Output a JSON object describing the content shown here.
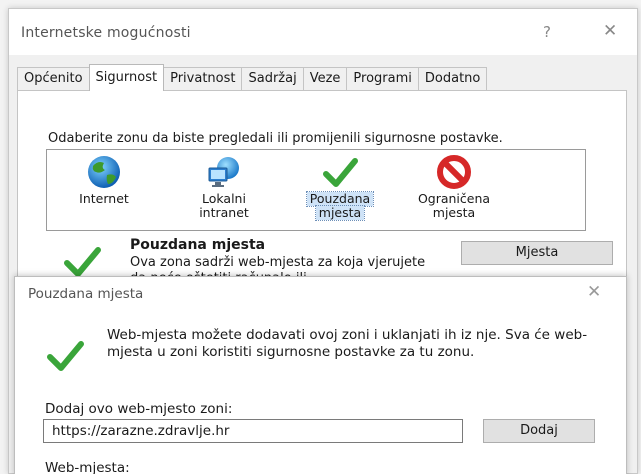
{
  "dialog": {
    "title": "Internetske mogućnosti",
    "help_glyph": "?",
    "close_glyph": "✕",
    "tabs": [
      {
        "label": "Općenito",
        "active": false
      },
      {
        "label": "Sigurnost",
        "active": true
      },
      {
        "label": "Privatnost",
        "active": false
      },
      {
        "label": "Sadržaj",
        "active": false
      },
      {
        "label": "Veze",
        "active": false
      },
      {
        "label": "Programi",
        "active": false
      },
      {
        "label": "Dodatno",
        "active": false
      }
    ]
  },
  "security": {
    "instruction": "Odaberite zonu da biste pregledali ili promijenili sigurnosne postavke.",
    "zones": [
      {
        "icon": "globe-icon",
        "label_line1": "Internet",
        "label_line2": ""
      },
      {
        "icon": "network-computers-icon",
        "label_line1": "Lokalni",
        "label_line2": "intranet"
      },
      {
        "icon": "green-checkmark-icon",
        "label_line1": "Pouzdana",
        "label_line2": "mjesta",
        "selected": true
      },
      {
        "icon": "prohibited-icon",
        "label_line1": "Ograničena",
        "label_line2": "mjesta"
      }
    ],
    "selected_zone_name": "Pouzdana mjesta",
    "selected_zone_desc": "Ova zona sadrži web-mjesta za koja vjerujete da neće oštetiti računalo ili",
    "sites_button": "Mjesta"
  },
  "trusted_sites": {
    "title": "Pouzdana mjesta",
    "close_glyph": "✕",
    "info_text": "Web-mjesta možete dodavati ovoj zoni i uklanjati ih iz nje. Sva će web-mjesta u zoni koristiti sigurnosne postavke za tu zonu.",
    "add_label": "Dodaj ovo web-mjesto zoni:",
    "site_input_value": "https://zarazne.zdravlje.hr",
    "add_button": "Dodaj",
    "websites_label": "Web-mjesta:"
  },
  "colors": {
    "check_green": "#3aa53a",
    "prohibited_red": "#d62828",
    "selection_blue": "#cfe3f7"
  }
}
